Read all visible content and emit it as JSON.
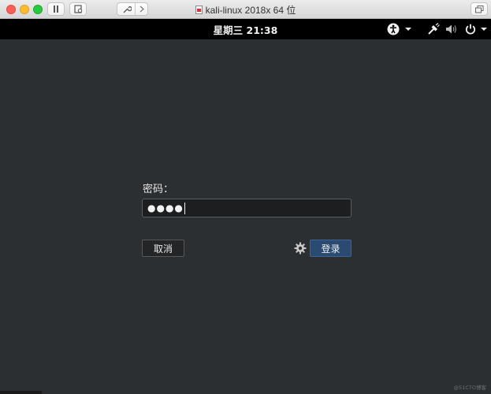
{
  "vm_window": {
    "title": "kali-linux 2018x 64 位"
  },
  "gnome_bar": {
    "clock": "星期三 21:38",
    "icons": [
      "accessibility-icon",
      "network-icon",
      "volume-icon",
      "power-icon"
    ]
  },
  "login": {
    "password_label": "密码：",
    "password_value": "●●●●",
    "cancel_label": "取消",
    "login_label": "登录"
  },
  "watermark": "@51CTO博客",
  "colors": {
    "background": "#2c2f31",
    "topbar": "#000000",
    "login_button": "#2a4a72"
  }
}
